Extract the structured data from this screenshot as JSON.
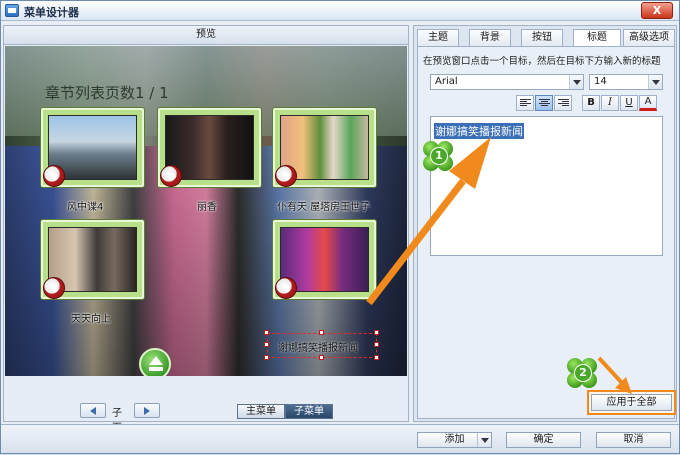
{
  "window": {
    "title": "菜单设计器",
    "close_label": "X"
  },
  "preview": {
    "header": "预览",
    "page_title": "章节列表页数1 / 1",
    "thumbnails": [
      {
        "label": "风中谍4"
      },
      {
        "label": "丽香"
      },
      {
        "label": "仆有天 屋塔房王世子"
      },
      {
        "label": "天天向上"
      },
      {
        "label": "谢娜搞笑播报新闻"
      }
    ],
    "selected_text": "谢娜搞笑播报新闻",
    "pager": {
      "label": "子页"
    },
    "menu_tabs": {
      "main": "主菜单",
      "sub": "子菜单"
    }
  },
  "settings": {
    "tabs": [
      "主题",
      "背景",
      "按钮",
      "标题",
      "高级选项"
    ],
    "active_tab": "标题",
    "hint": "在预览窗口点击一个目标，然后在目标下方输入新的标题",
    "font": "Arial",
    "size": "14",
    "format": {
      "bold": "B",
      "italic": "I",
      "underline": "U",
      "color": "A"
    },
    "title_text": "谢娜搞笑播报新闻",
    "apply_all": "应用于全部",
    "badges": [
      "1",
      "2"
    ]
  },
  "bottom": {
    "add": "添加",
    "ok": "确定",
    "cancel": "取消"
  },
  "colors": {
    "accent_orange": "#f08a1c",
    "selection": "#3a6fb7",
    "active_tab": "#284669"
  }
}
